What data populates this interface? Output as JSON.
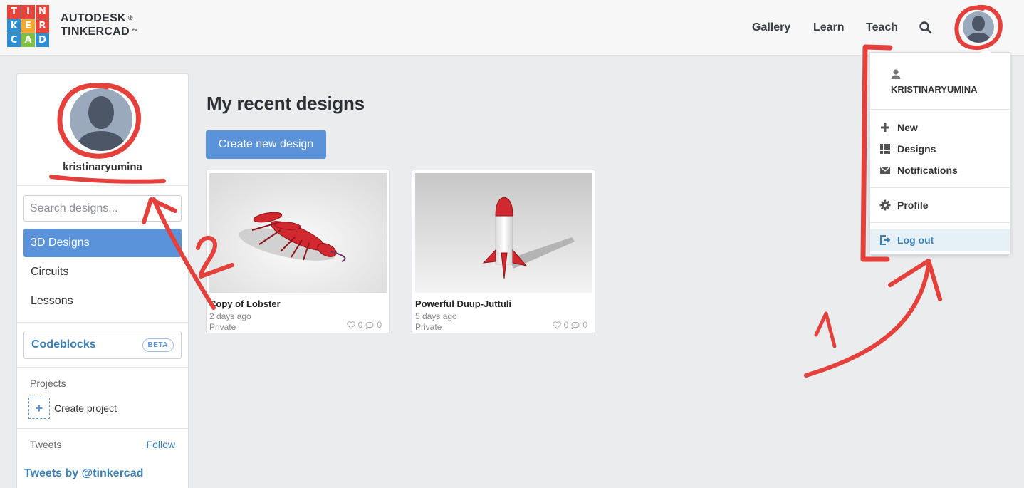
{
  "header": {
    "logo_letters": [
      "T",
      "I",
      "N",
      "K",
      "E",
      "R",
      "C",
      "A",
      "D"
    ],
    "logo_colors": [
      "#e8433a",
      "#e8433a",
      "#e8433a",
      "#2d8ed1",
      "#f7a72c",
      "#e8433a",
      "#2d8ed1",
      "#7dbf3e",
      "#2d8ed1"
    ],
    "brand_line1": "AUTODESK",
    "brand_line1_mark": "®",
    "brand_line2": "TINKERCAD",
    "brand_line2_mark": "™",
    "nav": {
      "gallery": "Gallery",
      "learn": "Learn",
      "teach": "Teach"
    }
  },
  "dropdown": {
    "username": "KRISTINARYUMINA",
    "items": {
      "new": "New",
      "designs": "Designs",
      "notifications": "Notifications",
      "profile": "Profile",
      "logout": "Log out"
    }
  },
  "sidebar": {
    "username": "kristinaryumina",
    "search_placeholder": "Search designs...",
    "menu": {
      "designs3d": "3D Designs",
      "circuits": "Circuits",
      "lessons": "Lessons"
    },
    "codeblocks": "Codeblocks",
    "beta": "BETA",
    "projects_label": "Projects",
    "create_project": "Create project",
    "tweets_label": "Tweets",
    "follow": "Follow",
    "tweets_by": "Tweets by @tinkercad"
  },
  "main": {
    "title": "My recent designs",
    "create_button": "Create new design",
    "designs": [
      {
        "name": "Copy of Lobster",
        "time": "2 days ago",
        "privacy": "Private",
        "likes": "0",
        "comments": "0"
      },
      {
        "name": "Powerful Duup-Juttuli",
        "time": "5 days ago",
        "privacy": "Private",
        "likes": "0",
        "comments": "0"
      }
    ]
  },
  "annotations": {
    "arrow1_label": "1",
    "arrow2_label": "2"
  },
  "colors": {
    "accent": "#5a93d9",
    "link": "#3b80b5",
    "annotation": "#e5413c"
  }
}
